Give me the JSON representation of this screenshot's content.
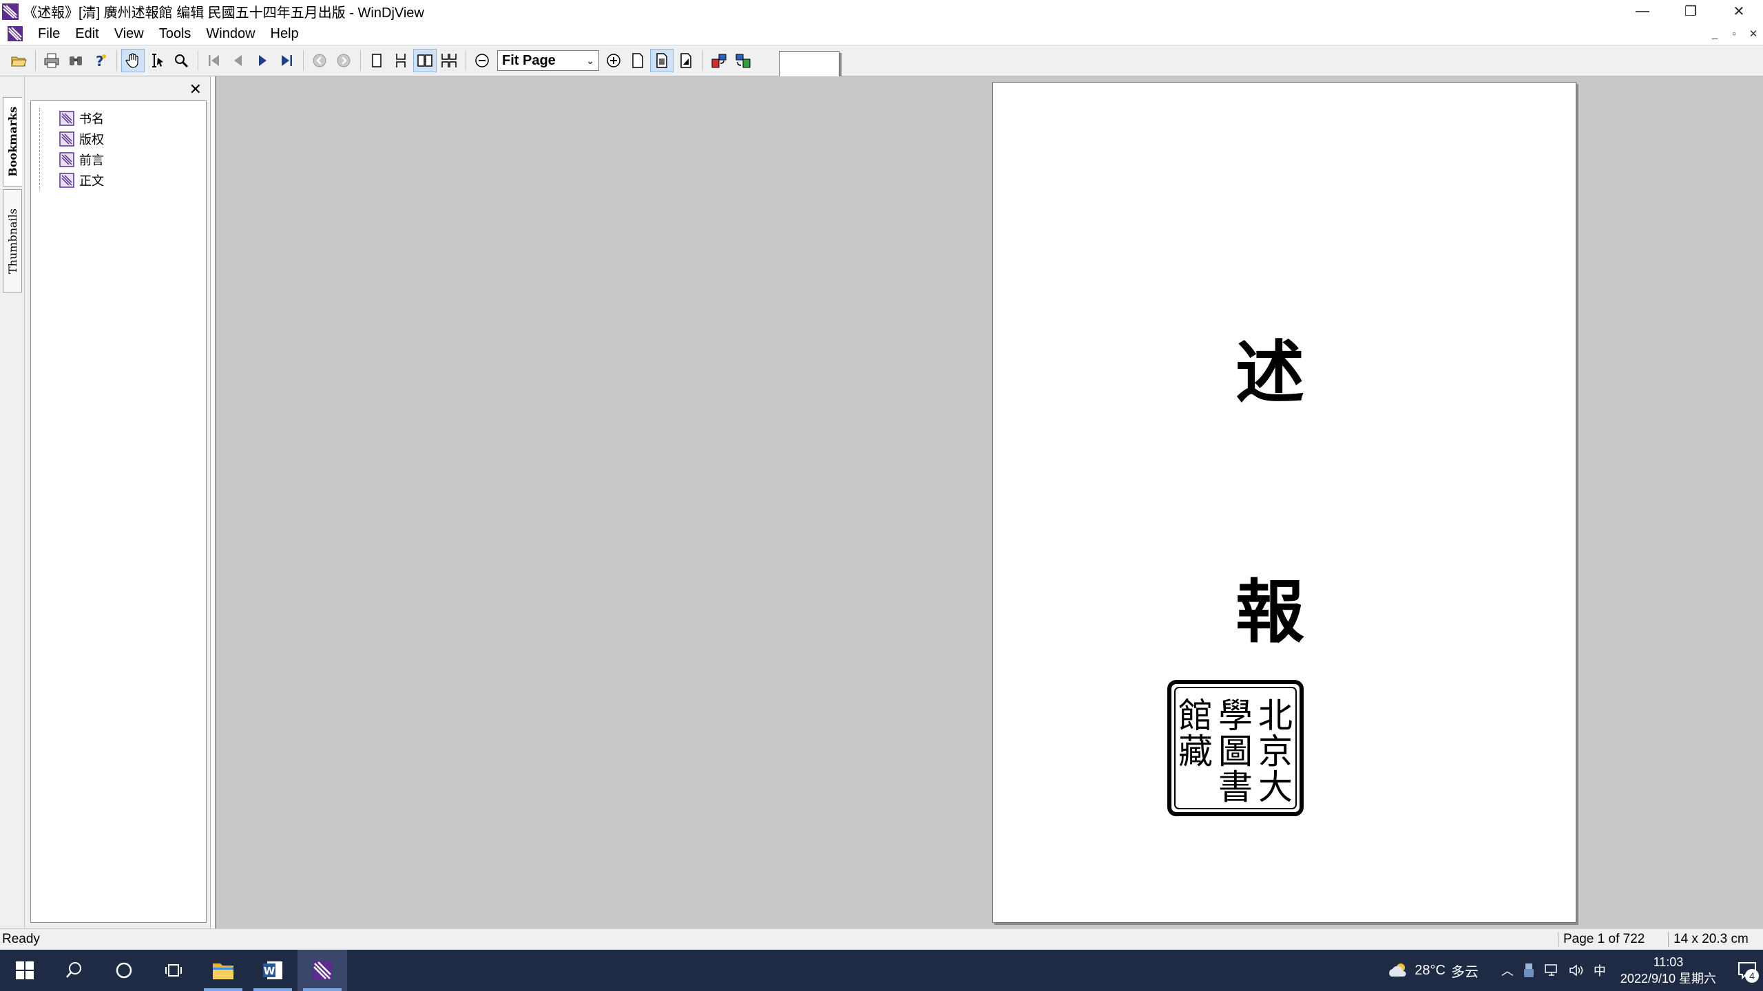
{
  "window": {
    "title": "《述報》[清] 廣州述報館 编辑  民國五十四年五月出版 - WinDjView",
    "minimize_glyph": "—",
    "restore_glyph": "❐",
    "close_glyph": "✕"
  },
  "menu": {
    "items": [
      "File",
      "Edit",
      "View",
      "Tools",
      "Window",
      "Help"
    ]
  },
  "mdi": {
    "minimize": "_",
    "restore": "▫",
    "close": "✕"
  },
  "toolbar": {
    "page_value": "1",
    "zoom_value": "Fit Page",
    "combo_arrow": "⌄"
  },
  "sidetabs": {
    "bookmarks": "Bookmarks",
    "thumbnails": "Thumbnails"
  },
  "bookmarks": {
    "close_glyph": "✕",
    "items": [
      "书名",
      "版权",
      "前言",
      "正文"
    ]
  },
  "document": {
    "char_1": "述",
    "char_2": "報",
    "seal_chars": [
      "北",
      "京",
      "大",
      "學",
      "圖",
      "書",
      "館",
      "藏"
    ]
  },
  "status": {
    "ready": "Ready",
    "page_info": "Page 1 of 722",
    "size_info": "14 x 20.3 cm"
  },
  "taskbar": {
    "weather_temp": "28°C",
    "weather_desc": "多云",
    "ime": "中",
    "time": "11:03",
    "date": "2022/9/10 星期六",
    "notification_count": "4"
  },
  "colors": {
    "taskbar": "#1f2a44",
    "doc_background": "#c8c8c8",
    "toolbar": "#f0f0f0",
    "app_icon": "#5b2d8e"
  }
}
